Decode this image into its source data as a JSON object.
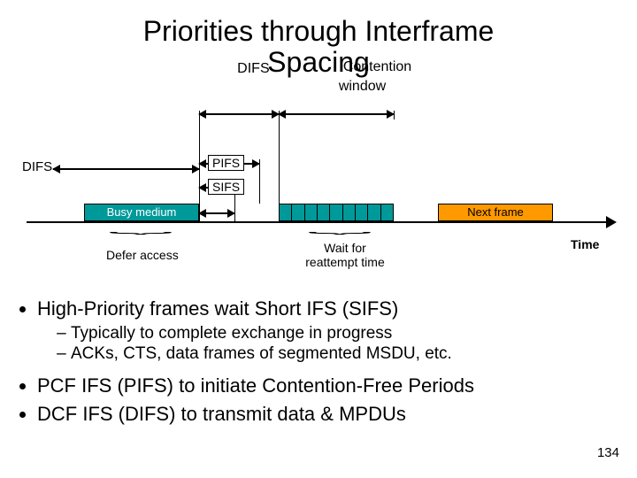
{
  "title": {
    "line1": "Priorities through Interframe",
    "line2": "Spacing",
    "overlay_difs": "DIFS",
    "overlay_contention": "Contention",
    "overlay_window": "window"
  },
  "diagram": {
    "difs_left": "DIFS",
    "pifs": "PIFS",
    "sifs": "SIFS",
    "busy": "Busy medium",
    "next_frame": "Next frame",
    "defer": "Defer access",
    "wait": "Wait for reattempt time",
    "time": "Time",
    "cw_slots": 9
  },
  "bullets": {
    "b1": "High-Priority frames wait Short IFS (SIFS)",
    "b1a": "Typically to complete exchange in progress",
    "b1b": "ACKs, CTS, data frames of segmented MSDU, etc.",
    "b2": "PCF IFS (PIFS) to initiate Contention-Free Periods",
    "b3": "DCF IFS (DIFS) to transmit data & MPDUs"
  },
  "page_number": "134"
}
